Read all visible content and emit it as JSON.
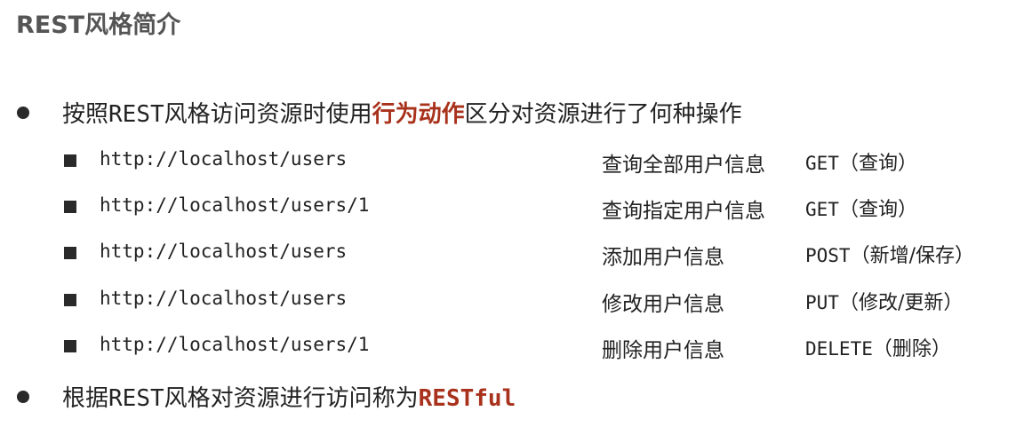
{
  "title": "REST风格简介",
  "bullet1": {
    "prefix": "按照",
    "rest": "REST",
    "middle": "风格访问资源时使用",
    "highlight": "行为动作",
    "suffix": "区分对资源进行了何种操作"
  },
  "rows": [
    {
      "url": "http://localhost/users",
      "desc": "查询全部用户信息",
      "method": "GET",
      "note": "（查询）"
    },
    {
      "url": "http://localhost/users/1",
      "desc": "查询指定用户信息",
      "method": "GET",
      "note": "（查询）"
    },
    {
      "url": "http://localhost/users",
      "desc": "添加用户信息",
      "method": "POST",
      "note": "（新增/保存）"
    },
    {
      "url": "http://localhost/users",
      "desc": "修改用户信息",
      "method": "PUT",
      "note": "（修改/更新）"
    },
    {
      "url": "http://localhost/users/1",
      "desc": "删除用户信息",
      "method": "DELETE",
      "note": "（删除）"
    }
  ],
  "bullet2": {
    "prefix": "根据",
    "rest": "REST",
    "middle": "风格对资源进行访问称为",
    "highlight": "RESTful"
  }
}
